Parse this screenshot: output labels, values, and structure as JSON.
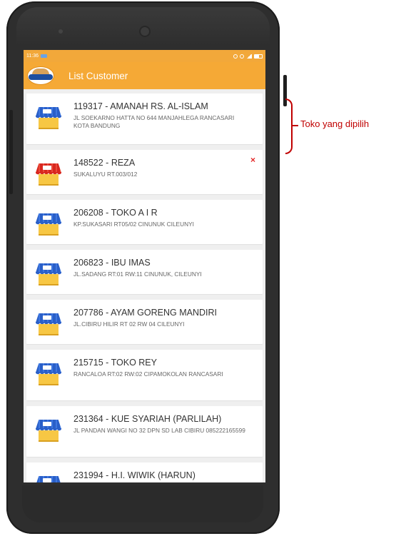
{
  "status_bar": {
    "time": "11:36"
  },
  "app_bar": {
    "title": "List Customer"
  },
  "customers": [
    {
      "name": "119317 - AMANAH RS. AL-ISLAM",
      "address": "JL SOEKARNO HATTA NO 644 MANJAHLEGA RANCASARI KOTA BANDUNG",
      "awning_color": "blue"
    },
    {
      "name": "148522 - REZA",
      "address": "SUKALUYU RT.003/012",
      "awning_color": "red",
      "delete_label": "×"
    },
    {
      "name": "206208 - TOKO A I R",
      "address": "KP.SUKASARI RT05/02 CINUNUK CILEUNYI",
      "awning_color": "blue"
    },
    {
      "name": "206823 - IBU IMAS",
      "address": "JL.SADANG RT:01 RW:11 CINUNUK, CILEUNYI",
      "awning_color": "blue"
    },
    {
      "name": "207786 - AYAM GORENG MANDIRI",
      "address": "JL.CIBIRU HILIR RT 02 RW 04 CILEUNYI",
      "awning_color": "blue"
    },
    {
      "name": "215715 - TOKO REY",
      "address": "RANCALOA RT:02 RW:02 CIPAMOKOLAN RANCASARI",
      "awning_color": "blue"
    },
    {
      "name": "231364 - KUE SYARIAH (PARLILAH)",
      "address": "JL PANDAN WANGI NO 32 DPN SD LAB CIBIRU 085222165599",
      "awning_color": "blue"
    },
    {
      "name": "231994 - H.I. WIWIK (HARUN)",
      "address": "",
      "awning_color": "blue"
    }
  ],
  "annotation": {
    "label": "Toko yang dipilih",
    "color": "#c00000"
  },
  "colors": {
    "app_bar": "#f5a936",
    "delete": "#e32626"
  }
}
